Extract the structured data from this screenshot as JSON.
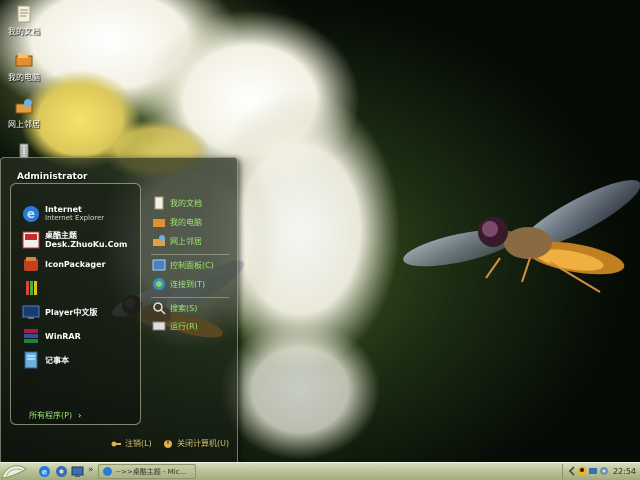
{
  "desktop": {
    "icons": [
      {
        "label": "我的文档",
        "icon": "my-documents-icon"
      },
      {
        "label": "我的电脑",
        "icon": "my-computer-icon"
      },
      {
        "label": "网上邻居",
        "icon": "network-places-icon"
      },
      {
        "label": "",
        "icon": "recycle-bin-icon"
      }
    ]
  },
  "start_menu": {
    "user": "Administrator",
    "programs": [
      {
        "title": "Internet",
        "subtitle": "Internet Explorer",
        "icon": "internet-explorer-icon"
      },
      {
        "title": "桌酷主题",
        "subtitle": "Desk.ZhuoKu.Com",
        "icon": "zhuoku-theme-icon"
      },
      {
        "title": "IconPackager",
        "subtitle": "",
        "icon": "iconpackager-icon"
      },
      {
        "title": "",
        "subtitle": "",
        "icon": "paint-icon"
      },
      {
        "title": "Player中文版",
        "subtitle": "",
        "icon": "media-player-icon"
      },
      {
        "title": "WinRAR",
        "subtitle": "",
        "icon": "winrar-icon"
      },
      {
        "title": "记事本",
        "subtitle": "",
        "icon": "notepad-icon"
      }
    ],
    "all_programs": "所有程序(P)",
    "places": [
      {
        "label": "我的文档",
        "icon": "my-documents-icon"
      },
      {
        "label": "我的电脑",
        "icon": "my-computer-icon"
      },
      {
        "label": "网上邻居",
        "icon": "network-places-icon"
      },
      {
        "label": "控制面板(C)",
        "icon": "control-panel-icon"
      },
      {
        "label": "连接到(T)",
        "icon": "connect-to-icon"
      },
      {
        "label": "搜索(S)",
        "icon": "search-icon"
      },
      {
        "label": "运行(R)",
        "icon": "run-icon"
      }
    ],
    "logoff": "注销(L)",
    "shutdown": "关闭计算机(U)"
  },
  "taskbar": {
    "task_label": "-->>桌酷主题 - Mic...",
    "clock": "22:54"
  },
  "colors": {
    "menu_text": "#9fe870",
    "footer_text": "#d8c070",
    "taskbar": "#b6bf92"
  }
}
